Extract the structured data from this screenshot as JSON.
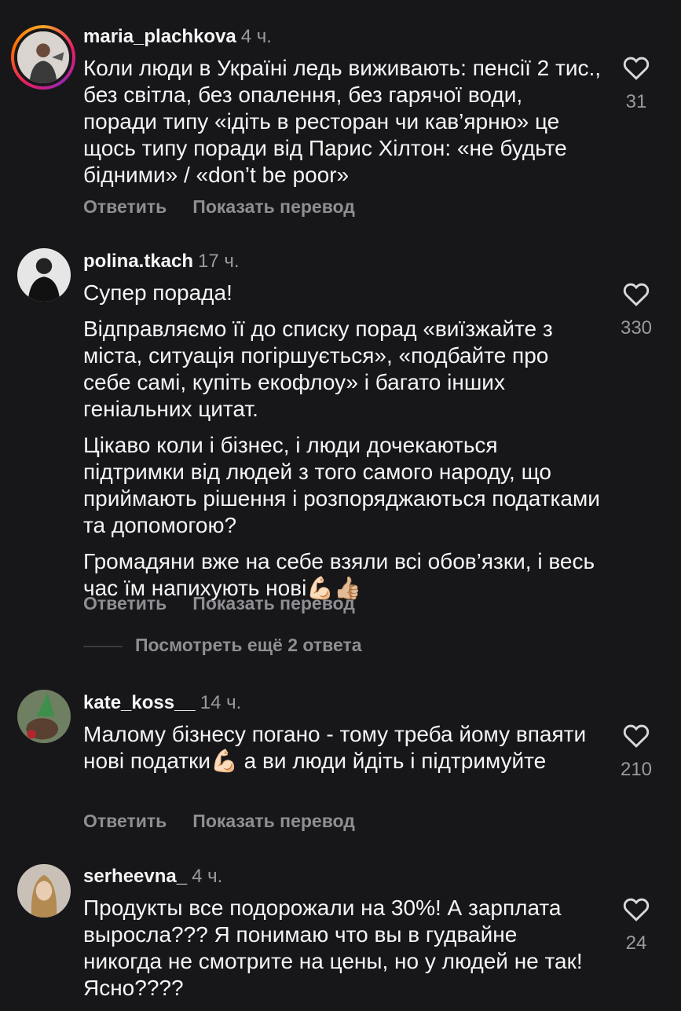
{
  "comments": [
    {
      "username": "maria_plachkova",
      "time": "4 ч.",
      "paragraphs": [
        "Коли люди  в Україні ледь виживають: пенсії 2 тис., без світла, без опалення, без гарячої води, поради типу «ідіть в ресторан чи кав’ярню» це  щось типу поради від Парис Хілтон: «не будьте бідними» / «don’t be poor»"
      ],
      "likes": "31",
      "reply_label": "Ответить",
      "translate_label": "Показать перевод"
    },
    {
      "username": "polina.tkach",
      "time": "17 ч.",
      "paragraphs": [
        "Супер порада!",
        "Відправляємо її до списку порад «виїзжайте з міста, ситуація погіршується», «подбайте про себе самі, купіть екофлоу» і багато інших геніальних цитат.",
        "Цікаво коли і бізнес, і люди дочекаються підтримки від людей з того самого народу, що приймають рішення і розпоряджаються податками та допомогою?",
        "Громадяни вже на себе взяли всі обов’язки, і весь час їм напихують нові💪🏻👍🏼"
      ],
      "likes": "330",
      "reply_label": "Ответить",
      "translate_label": "Показать перевод",
      "more_replies": "Посмотреть ещё 2 ответа"
    },
    {
      "username": "kate_koss__",
      "time": "14 ч.",
      "paragraphs": [
        "Малому бізнесу погано - тому треба йому впаяти нові податки💪🏻 а ви люди йдіть і підтримуйте"
      ],
      "likes": "210",
      "reply_label": "Ответить",
      "translate_label": "Показать перевод"
    },
    {
      "username": "serheevna_",
      "time": "4 ч.",
      "paragraphs": [
        "Продукты все подорожали на 30%! А зарплата выросла??? Я понимаю что вы в гудвайне никогда не смотрите на цены, но у людей не так! Ясно????"
      ],
      "likes": "24"
    }
  ],
  "icons": {
    "like": "heart-icon",
    "avatar": "user-avatar"
  },
  "colors": {
    "background": "#17171a",
    "text": "#f5f5f5",
    "muted": "#8e8e93"
  }
}
